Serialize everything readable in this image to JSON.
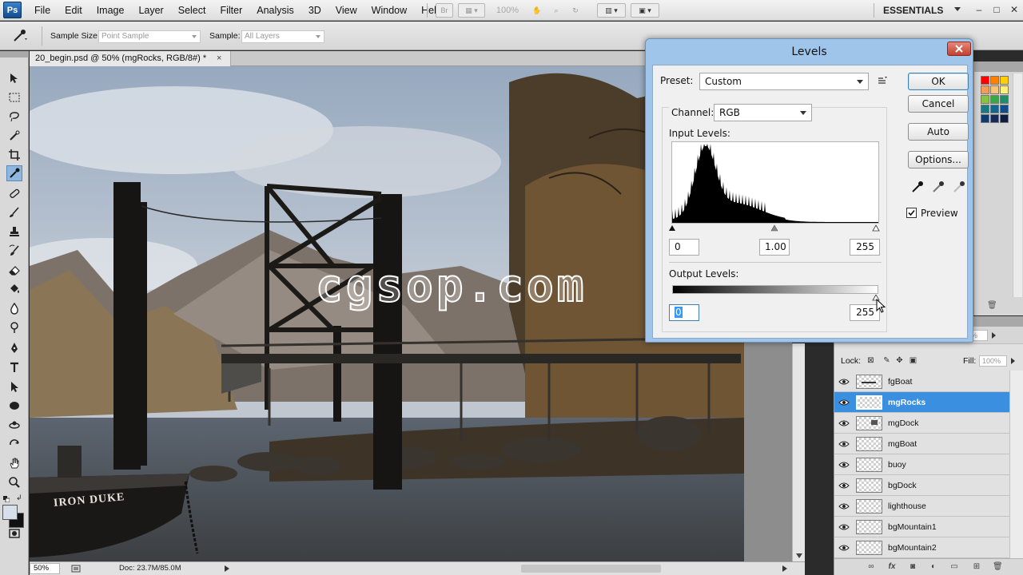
{
  "app": {
    "logo": "Ps",
    "menus": [
      "File",
      "Edit",
      "Image",
      "Layer",
      "Select",
      "Filter",
      "Analysis",
      "3D",
      "View",
      "Window",
      "Help"
    ],
    "bridge_label": "Br",
    "zoom": "100%",
    "workspace": "ESSENTIALS"
  },
  "options": {
    "sample_size_label": "Sample Size:",
    "sample_size_value": "Point Sample",
    "sample_label": "Sample:",
    "sample_value": "All Layers"
  },
  "document": {
    "tab_title": "20_begin.psd @ 50% (mgRocks, RGB/8#) *",
    "close_glyph": "×",
    "boat_name": "IRON DUKE",
    "status_zoom": "50%",
    "status_doc": "Doc: 23.7M/85.0M"
  },
  "watermark": "cgsop.com",
  "levels": {
    "title": "Levels",
    "preset_label": "Preset:",
    "preset_value": "Custom",
    "channel_label": "Channel:",
    "channel_value": "RGB",
    "input_label": "Input Levels:",
    "input_black": "0",
    "input_gamma": "1.00",
    "input_white": "255",
    "output_label": "Output Levels:",
    "output_black": "0",
    "output_white": "255",
    "buttons": {
      "ok": "OK",
      "cancel": "Cancel",
      "auto": "Auto",
      "options": "Options..."
    },
    "preview_label": "Preview",
    "preview_checked": true
  },
  "layers_panel": {
    "opacity": "100%",
    "lock_label": "Lock:",
    "fill_label": "Fill:",
    "fill": "100%",
    "layers": [
      {
        "name": "fgBoat",
        "selected": false
      },
      {
        "name": "mgRocks",
        "selected": true
      },
      {
        "name": "mgDock",
        "selected": false
      },
      {
        "name": "mgBoat",
        "selected": false
      },
      {
        "name": "buoy",
        "selected": false
      },
      {
        "name": "bgDock",
        "selected": false
      },
      {
        "name": "lighthouse",
        "selected": false
      },
      {
        "name": "bgMountain1",
        "selected": false
      },
      {
        "name": "bgMountain2",
        "selected": false
      }
    ]
  },
  "colors": {
    "selection_blue": "#3b8fe0",
    "dialog_frame": "#9fc6ea",
    "close_red": "#c2412f"
  }
}
